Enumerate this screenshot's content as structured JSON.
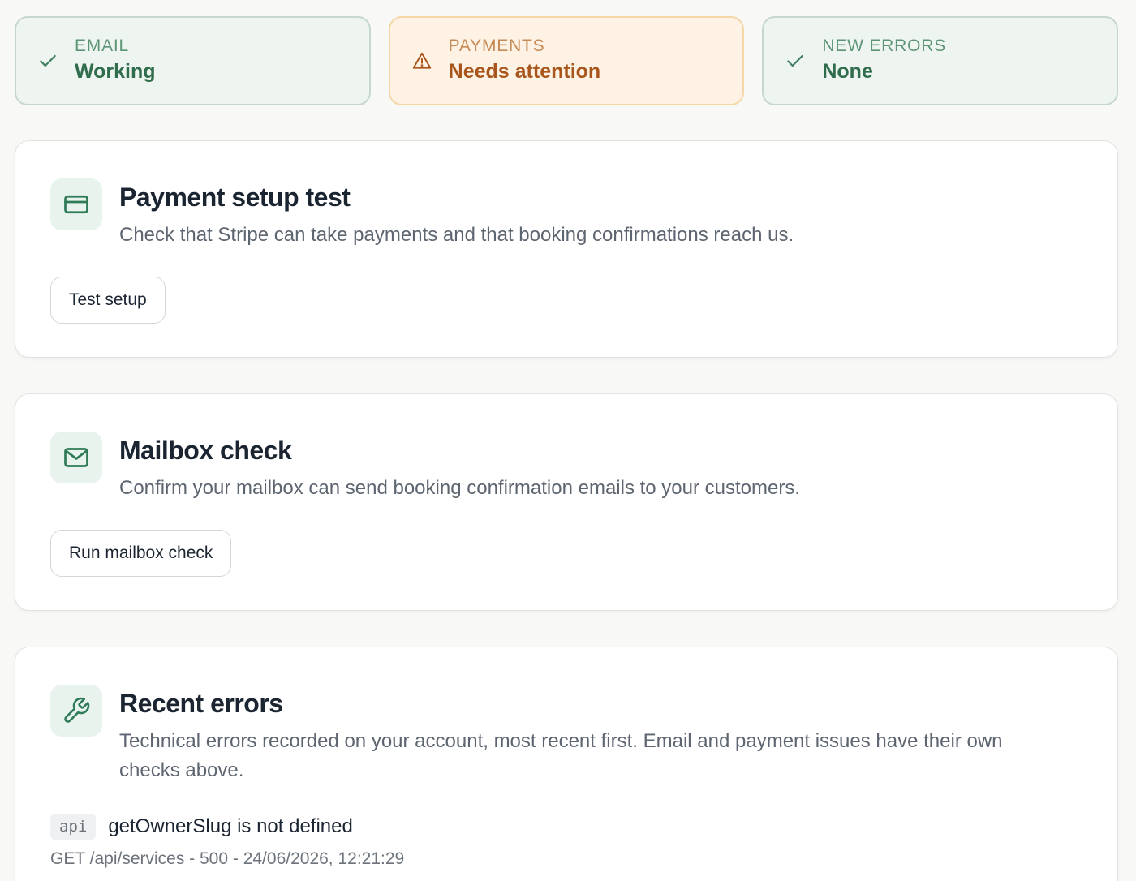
{
  "status_cards": [
    {
      "label": "EMAIL",
      "value": "Working",
      "icon": "check-icon",
      "state": "ok"
    },
    {
      "label": "PAYMENTS",
      "value": "Needs attention",
      "icon": "warning-icon",
      "state": "warn"
    },
    {
      "label": "NEW ERRORS",
      "value": "None",
      "icon": "check-icon",
      "state": "ok"
    }
  ],
  "payment_test": {
    "title": "Payment setup test",
    "description": "Check that Stripe can take payments and that booking confirmations reach us.",
    "button": "Test setup",
    "icon": "credit-card-icon"
  },
  "mailbox_check": {
    "title": "Mailbox check",
    "description": "Confirm your mailbox can send booking confirmation emails to your customers.",
    "button": "Run mailbox check",
    "icon": "mail-icon"
  },
  "recent_errors": {
    "title": "Recent errors",
    "description": "Technical errors recorded on your account, most recent first. Email and payment issues have their own checks above.",
    "icon": "wrench-icon",
    "items": [
      {
        "tag": "api",
        "message": "getOwnerSlug is not defined",
        "meta": "GET /api/services - 500 - 24/06/2026, 12:21:29"
      }
    ]
  },
  "colors": {
    "ok_text": "#2f6d4c",
    "warn_text": "#a8561c",
    "icon_green": "#2f7a57"
  }
}
